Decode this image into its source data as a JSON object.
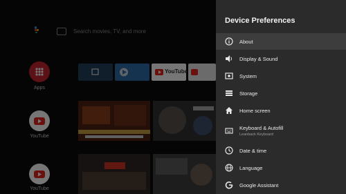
{
  "home": {
    "search_placeholder": "Search movies, TV, and more",
    "rows": [
      {
        "label": "Apps"
      },
      {
        "label": "YouTube"
      },
      {
        "label": "YouTube"
      }
    ],
    "youtube_tile_text": "YouTube"
  },
  "panel": {
    "title": "Device Preferences",
    "items": [
      {
        "label": "About",
        "sublabel": "",
        "icon": "info-icon"
      },
      {
        "label": "Display & Sound",
        "sublabel": "",
        "icon": "speaker-icon"
      },
      {
        "label": "System",
        "sublabel": "",
        "icon": "system-icon"
      },
      {
        "label": "Storage",
        "sublabel": "",
        "icon": "storage-icon"
      },
      {
        "label": "Home screen",
        "sublabel": "",
        "icon": "home-icon"
      },
      {
        "label": "Keyboard & Autofill",
        "sublabel": "Leanback Keyboard",
        "icon": "keyboard-icon"
      },
      {
        "label": "Date & time",
        "sublabel": "",
        "icon": "clock-icon"
      },
      {
        "label": "Language",
        "sublabel": "",
        "icon": "globe-icon"
      },
      {
        "label": "Google Assistant",
        "sublabel": "",
        "icon": "google-icon"
      }
    ],
    "selected_index": 0
  },
  "colors": {
    "panel_bg": "#2b2b2b",
    "selected_bg": "#3d3d3d",
    "youtube_red": "#e62117",
    "apps_red": "#c4212a"
  }
}
